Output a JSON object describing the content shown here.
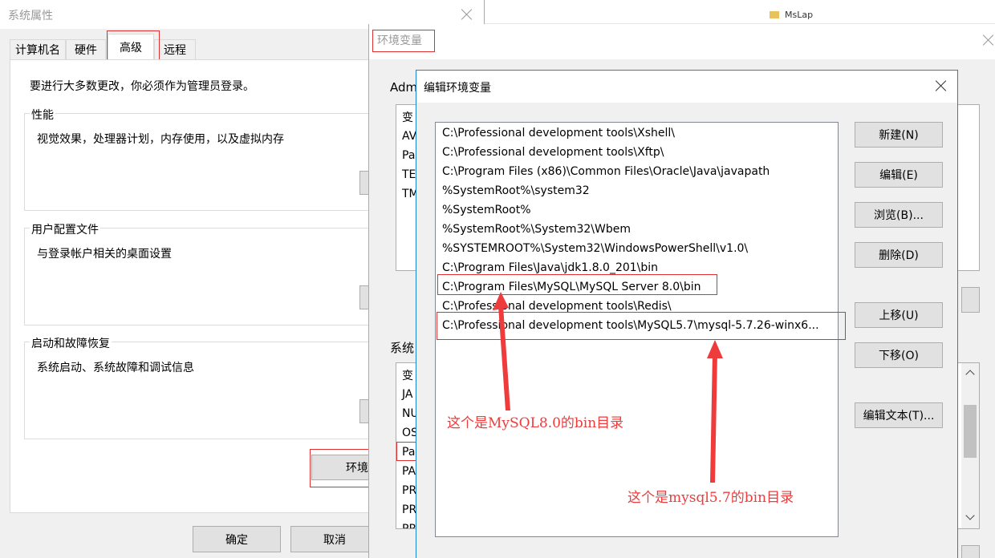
{
  "sys_props": {
    "title": "系统属性",
    "tabs": [
      "计算机名",
      "硬件",
      "高级",
      "远程"
    ],
    "admin_note": "要进行大多数更改，你必须作为管理员登录。",
    "groups": [
      {
        "title": "性能",
        "desc": "视觉效果，处理器计划，内存使用，以及虚拟内存"
      },
      {
        "title": "用户配置文件",
        "desc": "与登录帐户相关的桌面设置"
      },
      {
        "title": "启动和故障恢复",
        "desc": "系统启动、系统故障和调试信息"
      }
    ],
    "env_button": "环境",
    "ok": "确定",
    "cancel": "取消"
  },
  "env_vars": {
    "title": "环境变量",
    "user_section_label": "Adm",
    "user_header": "变",
    "user_vars": [
      "AV",
      "Pa",
      "TE",
      "TM"
    ],
    "sys_section_label": "系统",
    "sys_header": "变",
    "sys_vars": [
      "JA",
      "NU",
      "OS",
      "Pa",
      "PA",
      "PR",
      "PR",
      "PR"
    ]
  },
  "edit_env": {
    "title": "编辑环境变量",
    "paths": [
      "C:\\Professional development tools\\Xshell\\",
      "C:\\Professional development tools\\Xftp\\",
      "C:\\Program Files (x86)\\Common Files\\Oracle\\Java\\javapath",
      "%SystemRoot%\\system32",
      "%SystemRoot%",
      "%SystemRoot%\\System32\\Wbem",
      "%SYSTEMROOT%\\System32\\WindowsPowerShell\\v1.0\\",
      "C:\\Program Files\\Java\\jdk1.8.0_201\\bin",
      "C:\\Program Files\\MySQL\\MySQL Server 8.0\\bin",
      "C:\\Professional development tools\\Redis\\",
      "C:\\Professional development tools\\MySQL5.7\\mysql-5.7.26-winx6..."
    ],
    "buttons": {
      "new": "新建(N)",
      "edit": "编辑(E)",
      "browse": "浏览(B)...",
      "delete": "删除(D)",
      "up": "上移(U)",
      "down": "下移(O)",
      "edit_text": "编辑文本(T)..."
    }
  },
  "annotations": {
    "mysql8": "这个是MySQL8.0的bin目录",
    "mysql57": "这个是mysql5.7的bin目录"
  },
  "background": {
    "explorer_item": "MsLap"
  },
  "colors": {
    "annotation_red": "#ee3b3b",
    "highlight_box": "#e03030",
    "dialog_border": "#1883d7"
  }
}
